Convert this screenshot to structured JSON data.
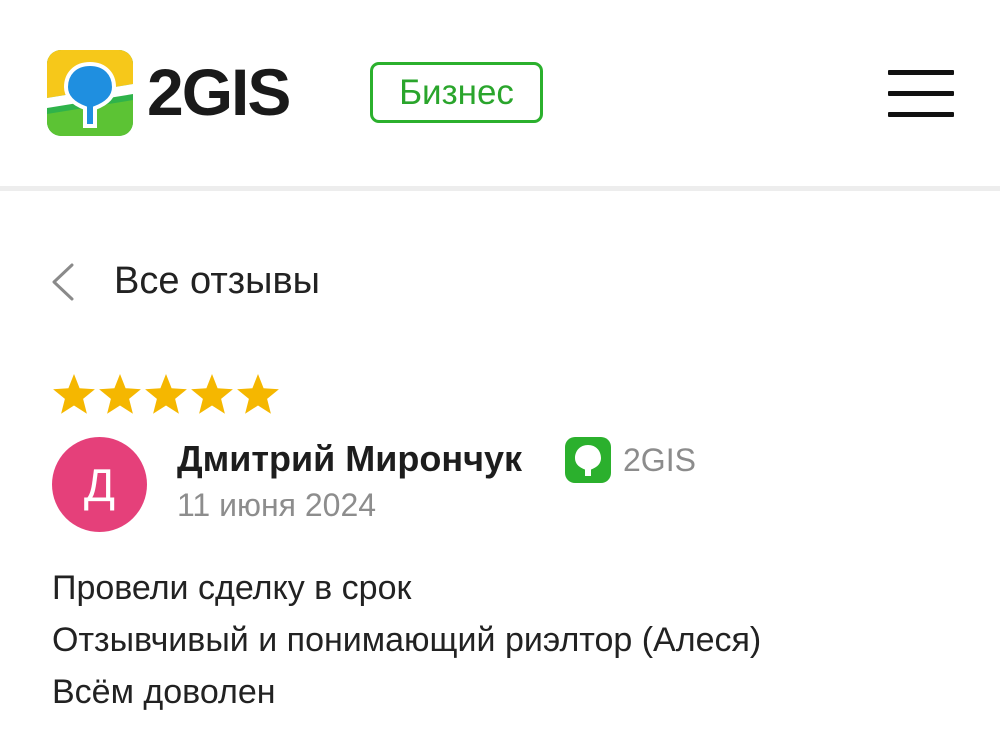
{
  "header": {
    "brand": "2GIS",
    "business_badge": "Бизнес",
    "colors": {
      "green": "#2bb02d",
      "yellow": "#f5c400",
      "blue": "#1e88e5"
    }
  },
  "nav": {
    "back_label": "Все отзывы"
  },
  "review": {
    "rating": 5,
    "rating_max": 5,
    "star_color": "#f5b700",
    "avatar_letter": "Д",
    "avatar_color": "#e5407a",
    "author": "Дмитрий Мирончук",
    "source": "2GIS",
    "date": "11 июня 2024",
    "lines": [
      "Провели сделку в срок",
      "Отзывчивый и понимающий риэлтор (Алеся)",
      "Всём доволен"
    ]
  }
}
